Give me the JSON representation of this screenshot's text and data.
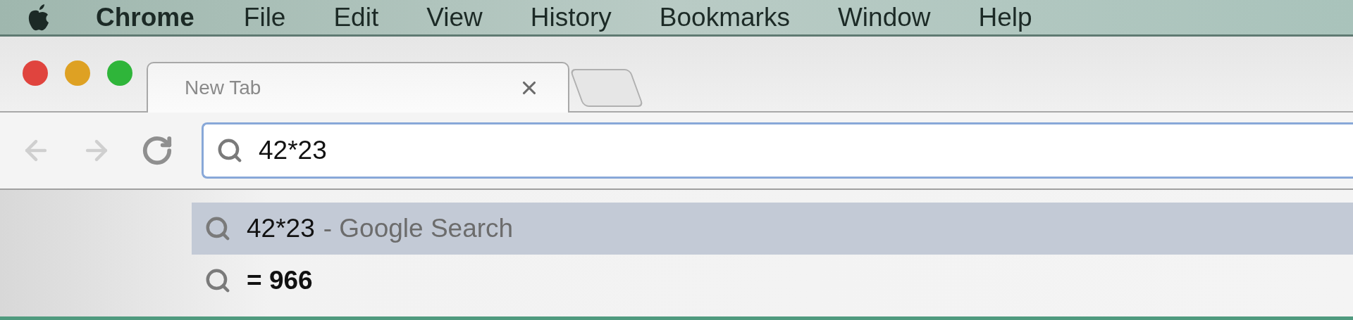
{
  "menu_bar": {
    "items": [
      {
        "label": "Chrome",
        "kind": "app"
      },
      {
        "label": "File",
        "kind": "menu"
      },
      {
        "label": "Edit",
        "kind": "menu"
      },
      {
        "label": "View",
        "kind": "menu"
      },
      {
        "label": "History",
        "kind": "menu"
      },
      {
        "label": "Bookmarks",
        "kind": "menu"
      },
      {
        "label": "Window",
        "kind": "menu"
      },
      {
        "label": "Help",
        "kind": "menu"
      }
    ]
  },
  "tabs": [
    {
      "label": "New Tab",
      "selected": true
    }
  ],
  "toolbar": {
    "buttons": [
      {
        "kind": "back",
        "disabled": true
      },
      {
        "kind": "forward",
        "disabled": true
      },
      {
        "kind": "reload",
        "disabled": false
      }
    ]
  },
  "address_bar": {
    "value": "42*23"
  },
  "suggestions": [
    {
      "kind": "search",
      "query": "42*23",
      "description": "- Google Search",
      "selected": true
    },
    {
      "kind": "answer",
      "query": "= 966",
      "selected": false
    }
  ]
}
